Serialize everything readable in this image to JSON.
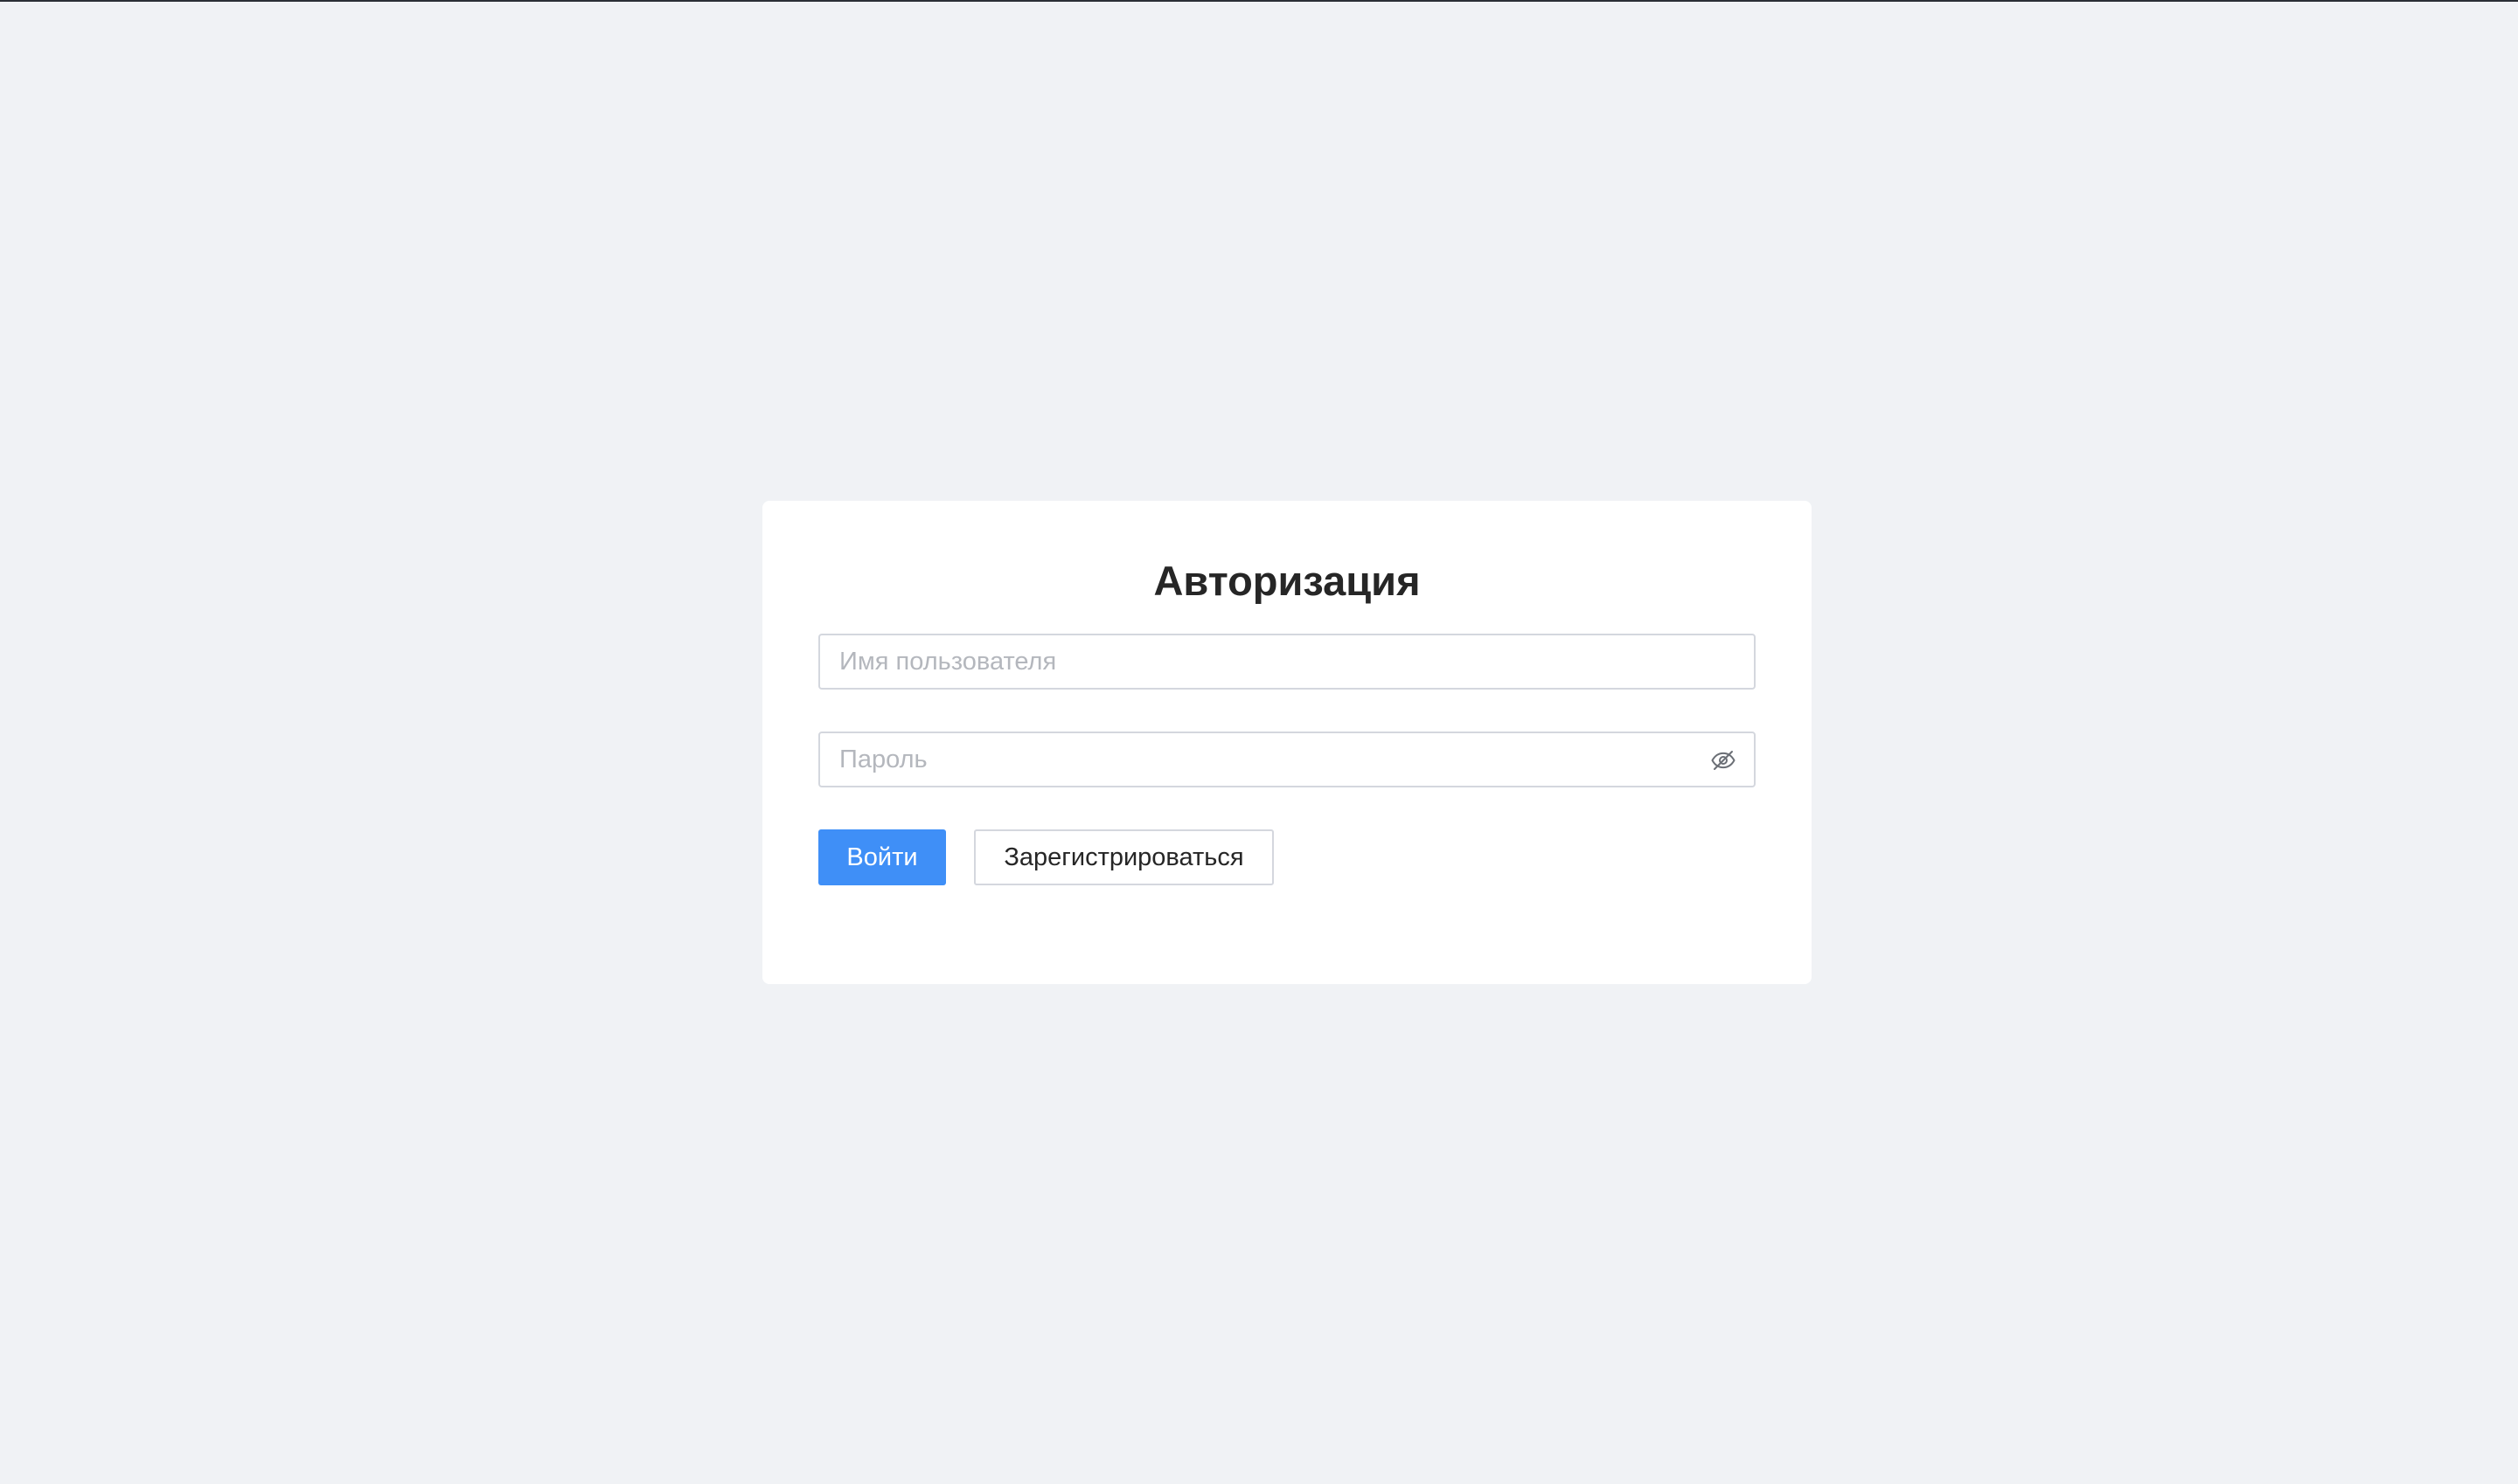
{
  "page": {
    "background_color": "#f0f2f5"
  },
  "login_card": {
    "title": "Авторизация",
    "username": {
      "value": "",
      "placeholder": "Имя пользователя"
    },
    "password": {
      "value": "",
      "placeholder": "Пароль",
      "toggle_icon": "eye-off-icon"
    },
    "buttons": {
      "login_label": "Войти",
      "register_label": "Зарегистрироваться"
    },
    "colors": {
      "primary": "#3f8ff7",
      "text": "#262626",
      "border": "#d4d7de",
      "placeholder": "#b4b7bd"
    }
  }
}
